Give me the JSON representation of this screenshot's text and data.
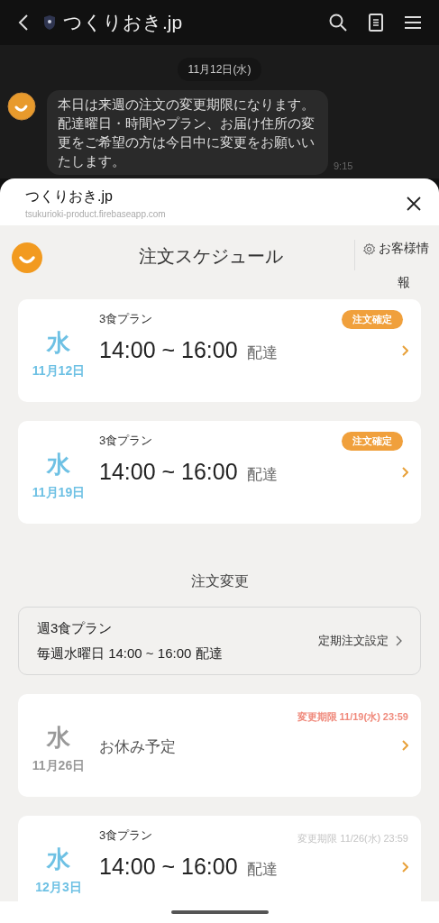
{
  "app_bar": {
    "title": "つくりおき.jp"
  },
  "chat": {
    "date": "11月12日(水)",
    "message": "本日は来週の注文の変更期限になります。配達曜日・時間やプラン、お届け住所の変更をご希望の方は今日中に変更をお願いいたします。",
    "time": "9:15"
  },
  "sheet": {
    "title": "つくりおき.jp",
    "url": "tsukurioki-product.firebaseapp.com"
  },
  "header": {
    "title": "注文スケジュール",
    "account_link": "お客様情報"
  },
  "schedule": [
    {
      "kind": "delivery",
      "weekday": "水",
      "date": "11月12日",
      "plan": "3食プラン",
      "time": "14:00 ~ 16:00",
      "suffix": "配達",
      "badge": "注文確定"
    },
    {
      "kind": "delivery",
      "weekday": "水",
      "date": "11月19日",
      "plan": "3食プラン",
      "time": "14:00 ~ 16:00",
      "suffix": "配達",
      "badge": "注文確定"
    }
  ],
  "change_section": {
    "title": "注文変更",
    "plan_name": "週3食プラン",
    "plan_detail": "毎週水曜日 14:00 ~ 16:00 配達",
    "link": "定期注文設定"
  },
  "changeable": [
    {
      "kind": "skip",
      "weekday": "水",
      "date": "11月26日",
      "label": "お休み予定",
      "deadline": "変更期限 11/19(水) 23:59",
      "urgent": true
    },
    {
      "kind": "delivery",
      "weekday": "水",
      "date": "12月3日",
      "plan": "3食プラン",
      "time": "14:00 ~ 16:00",
      "suffix": "配達",
      "deadline": "変更期限 11/26(水) 23:59",
      "urgent": false
    }
  ]
}
